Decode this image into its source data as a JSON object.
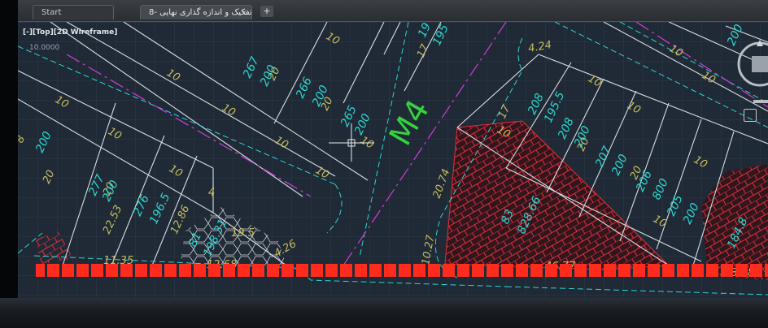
{
  "tabs": {
    "start_label": "Start",
    "drawing_label": "8- تفکیک و اندازه گذاری نهایی*",
    "close_glyph": "x",
    "add_glyph": "+"
  },
  "viewport": {
    "view_controls": "[-][Top][2D Wireframe]",
    "scale_text": "10.0000",
    "road_label": "M4"
  },
  "colors": {
    "model_background": "#1f2a36",
    "parcel_line": "#d9dde2",
    "dimension_yellow": "#c8bd5e",
    "parcel_cyan": "#2ed6d0",
    "centerline_magenta": "#d23bd8",
    "road_label_green": "#35d23d",
    "hatch_red": "#e0303a",
    "highlight_red": "#ff2c1e"
  },
  "labels": {
    "dim_10": "10",
    "dim_20": "20",
    "dim_17": "17",
    "d_4_24": "4.24",
    "d_20_74": "20.74",
    "d_10_27": "10.27",
    "d_11_35": "11.35",
    "d_12_86": "12.86",
    "d_22_53": "22.53",
    "d_12_68": "12.68",
    "d_19_5": "19.5",
    "d_4_26": "4.26",
    "d_46_77": "46.77",
    "d_33_38": "33.38",
    "p277": "277",
    "a200": "200",
    "p276": "276",
    "a196_5": "196.5",
    "p267": "267",
    "p266": "266",
    "p265": "265",
    "p208": "208",
    "a195_5": "195.5",
    "p207": "207",
    "p206": "206",
    "p205": "205",
    "a800": "800",
    "p83": "83",
    "a828_66": "828.66",
    "p81": "81",
    "a198_31": "198.31",
    "a184_8": "184.8",
    "p19": "19",
    "a195": "195",
    "p8": "8",
    "p4": "4"
  }
}
